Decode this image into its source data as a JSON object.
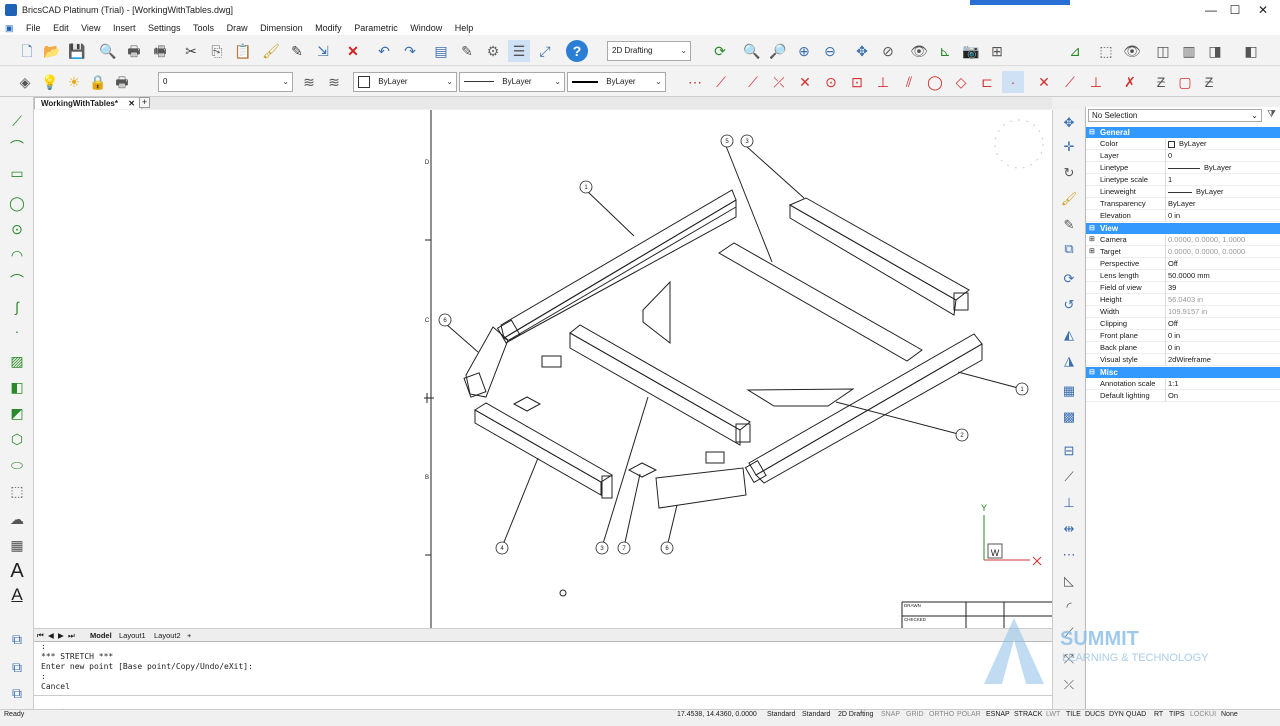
{
  "window": {
    "title": "BricsCAD Platinum (Trial) - [WorkingWithTables.dwg]",
    "min_label": "—",
    "max_label": "☐",
    "close_label": "✕"
  },
  "menu": [
    "File",
    "Edit",
    "View",
    "Insert",
    "Settings",
    "Tools",
    "Draw",
    "Dimension",
    "Modify",
    "Parametric",
    "Window",
    "Help"
  ],
  "toolbar": {
    "workspace": "2D Drafting",
    "layer": "0",
    "color": "ByLayer",
    "linetype": "ByLayer",
    "lineweight": "ByLayer"
  },
  "doc_tab": {
    "label": "WorkingWithTables*",
    "close": "✕",
    "add": "+"
  },
  "drawing": {
    "border_letters": [
      "D",
      "C",
      "B"
    ],
    "balloons": [
      "5",
      "3",
      "1",
      "6",
      "1",
      "2",
      "4",
      "3",
      "7",
      "6"
    ],
    "title_block": [
      "DRAWN",
      "CHECKED"
    ],
    "ucs": {
      "y": "Y",
      "w": "W"
    }
  },
  "properties": {
    "selection": "No Selection",
    "sections": [
      {
        "title": "General",
        "rows": [
          {
            "k": "Color",
            "v": "ByLayer",
            "grey": false
          },
          {
            "k": "Layer",
            "v": "0",
            "grey": false
          },
          {
            "k": "Linetype",
            "v": "ByLayer",
            "grey": false
          },
          {
            "k": "Linetype scale",
            "v": "1",
            "grey": false
          },
          {
            "k": "Lineweight",
            "v": "ByLayer",
            "grey": false
          },
          {
            "k": "Transparency",
            "v": "ByLayer",
            "grey": false
          },
          {
            "k": "Elevation",
            "v": "0 in",
            "grey": false
          }
        ]
      },
      {
        "title": "View",
        "rows": [
          {
            "k": "Camera",
            "v": "0.0000, 0.0000, 1.0000",
            "grey": true
          },
          {
            "k": "Target",
            "v": "0.0000, 0.0000, 0.0000",
            "grey": true
          },
          {
            "k": "Perspective",
            "v": "Off",
            "grey": false
          },
          {
            "k": "Lens length",
            "v": "50.0000 mm",
            "grey": false
          },
          {
            "k": "Field of view",
            "v": "39",
            "grey": false
          },
          {
            "k": "Height",
            "v": "56.0403 in",
            "grey": true
          },
          {
            "k": "Width",
            "v": "109.9157 in",
            "grey": true
          },
          {
            "k": "Clipping",
            "v": "Off",
            "grey": false
          },
          {
            "k": "Front plane",
            "v": "0 in",
            "grey": false
          },
          {
            "k": "Back plane",
            "v": "0 in",
            "grey": false
          },
          {
            "k": "Visual style",
            "v": "2dWireframe",
            "grey": false
          }
        ]
      },
      {
        "title": "Misc",
        "rows": [
          {
            "k": "Annotation scale",
            "v": "1:1",
            "grey": false
          },
          {
            "k": "Default lighting",
            "v": "On",
            "grey": false
          }
        ]
      }
    ]
  },
  "layout_tabs": [
    "Model",
    "Layout1",
    "Layout2",
    "+"
  ],
  "command_lines": [
    ":",
    "*** STRETCH ***",
    "Enter new point [Base point/Copy/Undo/eXit]:",
    ":",
    "Cancel"
  ],
  "command_prompt": ":",
  "status": {
    "ready": "Ready",
    "coords": "17.4538, 14.4360, 0.0000",
    "items": [
      "Standard",
      "Standard",
      "2D Drafting",
      "SNAP",
      "GRID",
      "ORTHO",
      "POLAR",
      "ESNAP",
      "STRACK",
      "LWT",
      "TILE",
      "DUCS",
      "DYN",
      "QUAD",
      "RT",
      "TIPS",
      "LOCKUI",
      "None"
    ]
  },
  "watermark": {
    "line1": "SUMMIT",
    "line2": "LEARNING & TECHNOLOGY"
  }
}
